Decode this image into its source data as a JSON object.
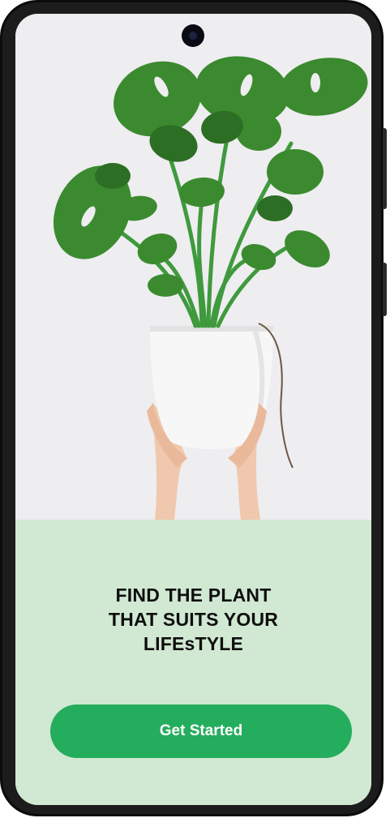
{
  "onboarding": {
    "headline_lines": [
      "FIND THE PLANT",
      "THAT SUITS YOUR",
      "LIFEsTYLE"
    ],
    "cta_label": "Get Started"
  },
  "colors": {
    "panel_background": "#d1e8d3",
    "cta_background": "#24ad5c",
    "cta_text": "#ffffff",
    "headline_text": "#0e0e0e"
  },
  "icons": {
    "hero_image": "potted-monstera-plant-image",
    "front_camera": "camera-cutout-icon"
  }
}
